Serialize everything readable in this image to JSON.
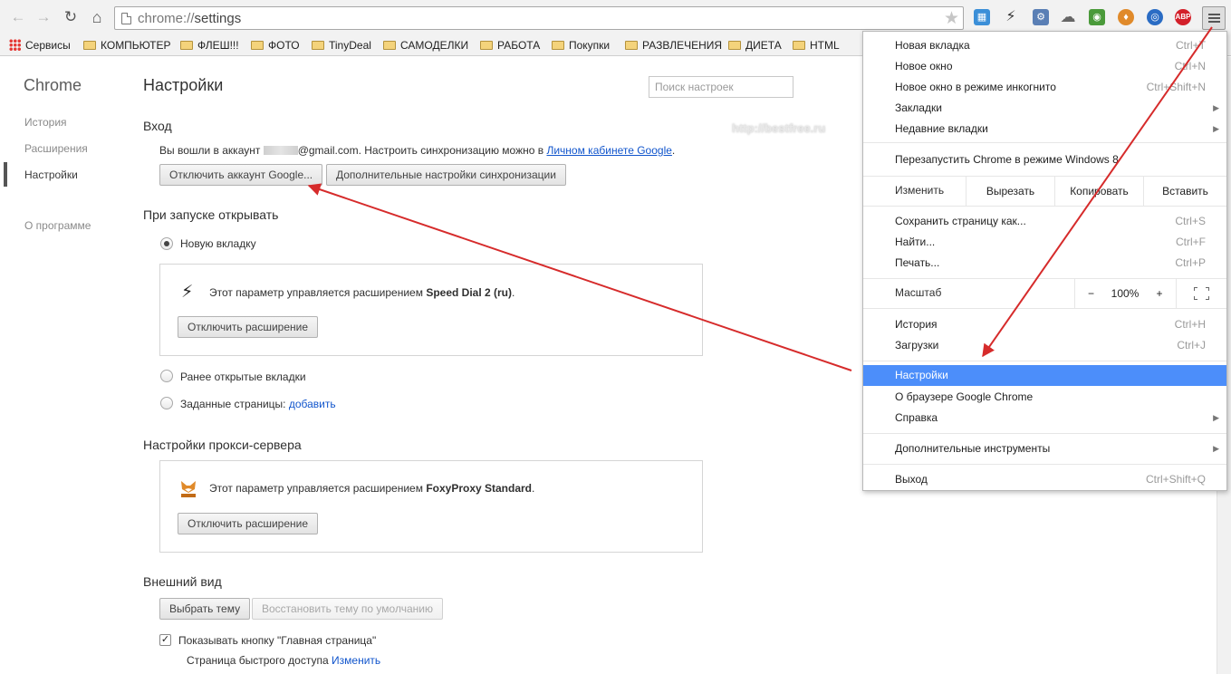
{
  "toolbar": {
    "url_scheme": "chrome://",
    "url_path": "settings"
  },
  "bookmarks": [
    {
      "label": "Сервисы",
      "type": "apps"
    },
    {
      "label": "КОМПЬЮТЕР",
      "type": "folder"
    },
    {
      "label": "ФЛЕШ!!!",
      "type": "folder"
    },
    {
      "label": "ФОТО",
      "type": "folder"
    },
    {
      "label": "TinyDeal",
      "type": "folder"
    },
    {
      "label": "САМОДЕЛКИ",
      "type": "folder"
    },
    {
      "label": "РАБОТА",
      "type": "folder"
    },
    {
      "label": "Покупки",
      "type": "folder"
    },
    {
      "label": "РАЗВЛЕЧЕНИЯ",
      "type": "folder"
    },
    {
      "label": "ДИЕТА",
      "type": "folder"
    },
    {
      "label": "HTML",
      "type": "folder"
    }
  ],
  "sidebar": {
    "brand": "Chrome",
    "items": [
      "История",
      "Расширения",
      "Настройки",
      "О программе"
    ],
    "active": "Настройки"
  },
  "main": {
    "title": "Настройки",
    "search_placeholder": "Поиск настроек",
    "signin": {
      "title": "Вход",
      "text_before": "Вы вошли в аккаунт",
      "text_after": "@gmail.com. Настроить синхронизацию можно в",
      "link": "Личном кабинете Google",
      "tail": ".",
      "btn_disconnect": "Отключить аккаунт Google...",
      "btn_sync": "Дополнительные настройки синхронизации"
    },
    "startup": {
      "title": "При запуске открывать",
      "option_new_tab": "Новую вкладку",
      "ext_notice_prefix": "Этот параметр управляется расширением",
      "ext_name": "Speed Dial 2 (ru)",
      "ext_notice_suffix": ".",
      "btn_disable_ext": "Отключить расширение",
      "option_prev": "Ранее открытые вкладки",
      "option_pages": "Заданные страницы:",
      "option_pages_link": "добавить"
    },
    "proxy": {
      "title": "Настройки прокси-сервера",
      "ext_notice_prefix": "Этот параметр управляется расширением",
      "ext_name": "FoxyProxy Standard",
      "ext_notice_suffix": ".",
      "btn_disable_ext": "Отключить расширение"
    },
    "appearance": {
      "title": "Внешний вид",
      "btn_theme": "Выбрать тему",
      "btn_reset_theme": "Восстановить тему по умолчанию",
      "show_home": "Показывать кнопку \"Главная страница\"",
      "home_page_text": "Страница быстрого доступа",
      "home_page_link": "Изменить"
    }
  },
  "watermark": "http://bestfree.ru",
  "menu": {
    "new_tab": {
      "label": "Новая вкладка",
      "shortcut": "Ctrl+T"
    },
    "new_window": {
      "label": "Новое окно",
      "shortcut": "Ctrl+N"
    },
    "incognito": {
      "label": "Новое окно в режиме инкогнито",
      "shortcut": "Ctrl+Shift+N"
    },
    "bookmarks": {
      "label": "Закладки"
    },
    "recent_tabs": {
      "label": "Недавние вкладки"
    },
    "relaunch_win8": {
      "label": "Перезапустить Chrome в режиме Windows 8"
    },
    "edit": {
      "label": "Изменить",
      "cut": "Вырезать",
      "copy": "Копировать",
      "paste": "Вставить"
    },
    "save_as": {
      "label": "Сохранить страницу как...",
      "shortcut": "Ctrl+S"
    },
    "find": {
      "label": "Найти...",
      "shortcut": "Ctrl+F"
    },
    "print": {
      "label": "Печать...",
      "shortcut": "Ctrl+P"
    },
    "zoom": {
      "label": "Масштаб",
      "minus": "−",
      "value": "100%",
      "plus": "+"
    },
    "history": {
      "label": "История",
      "shortcut": "Ctrl+H"
    },
    "downloads": {
      "label": "Загрузки",
      "shortcut": "Ctrl+J"
    },
    "settings": {
      "label": "Настройки"
    },
    "about": {
      "label": "О браузере Google Chrome"
    },
    "help": {
      "label": "Справка"
    },
    "more_tools": {
      "label": "Дополнительные инструменты"
    },
    "exit": {
      "label": "Выход",
      "shortcut": "Ctrl+Shift+Q"
    }
  },
  "colors": {
    "accent": "#4c8efa",
    "link": "#1155cc",
    "annotation_arrow": "#d62b2b"
  }
}
